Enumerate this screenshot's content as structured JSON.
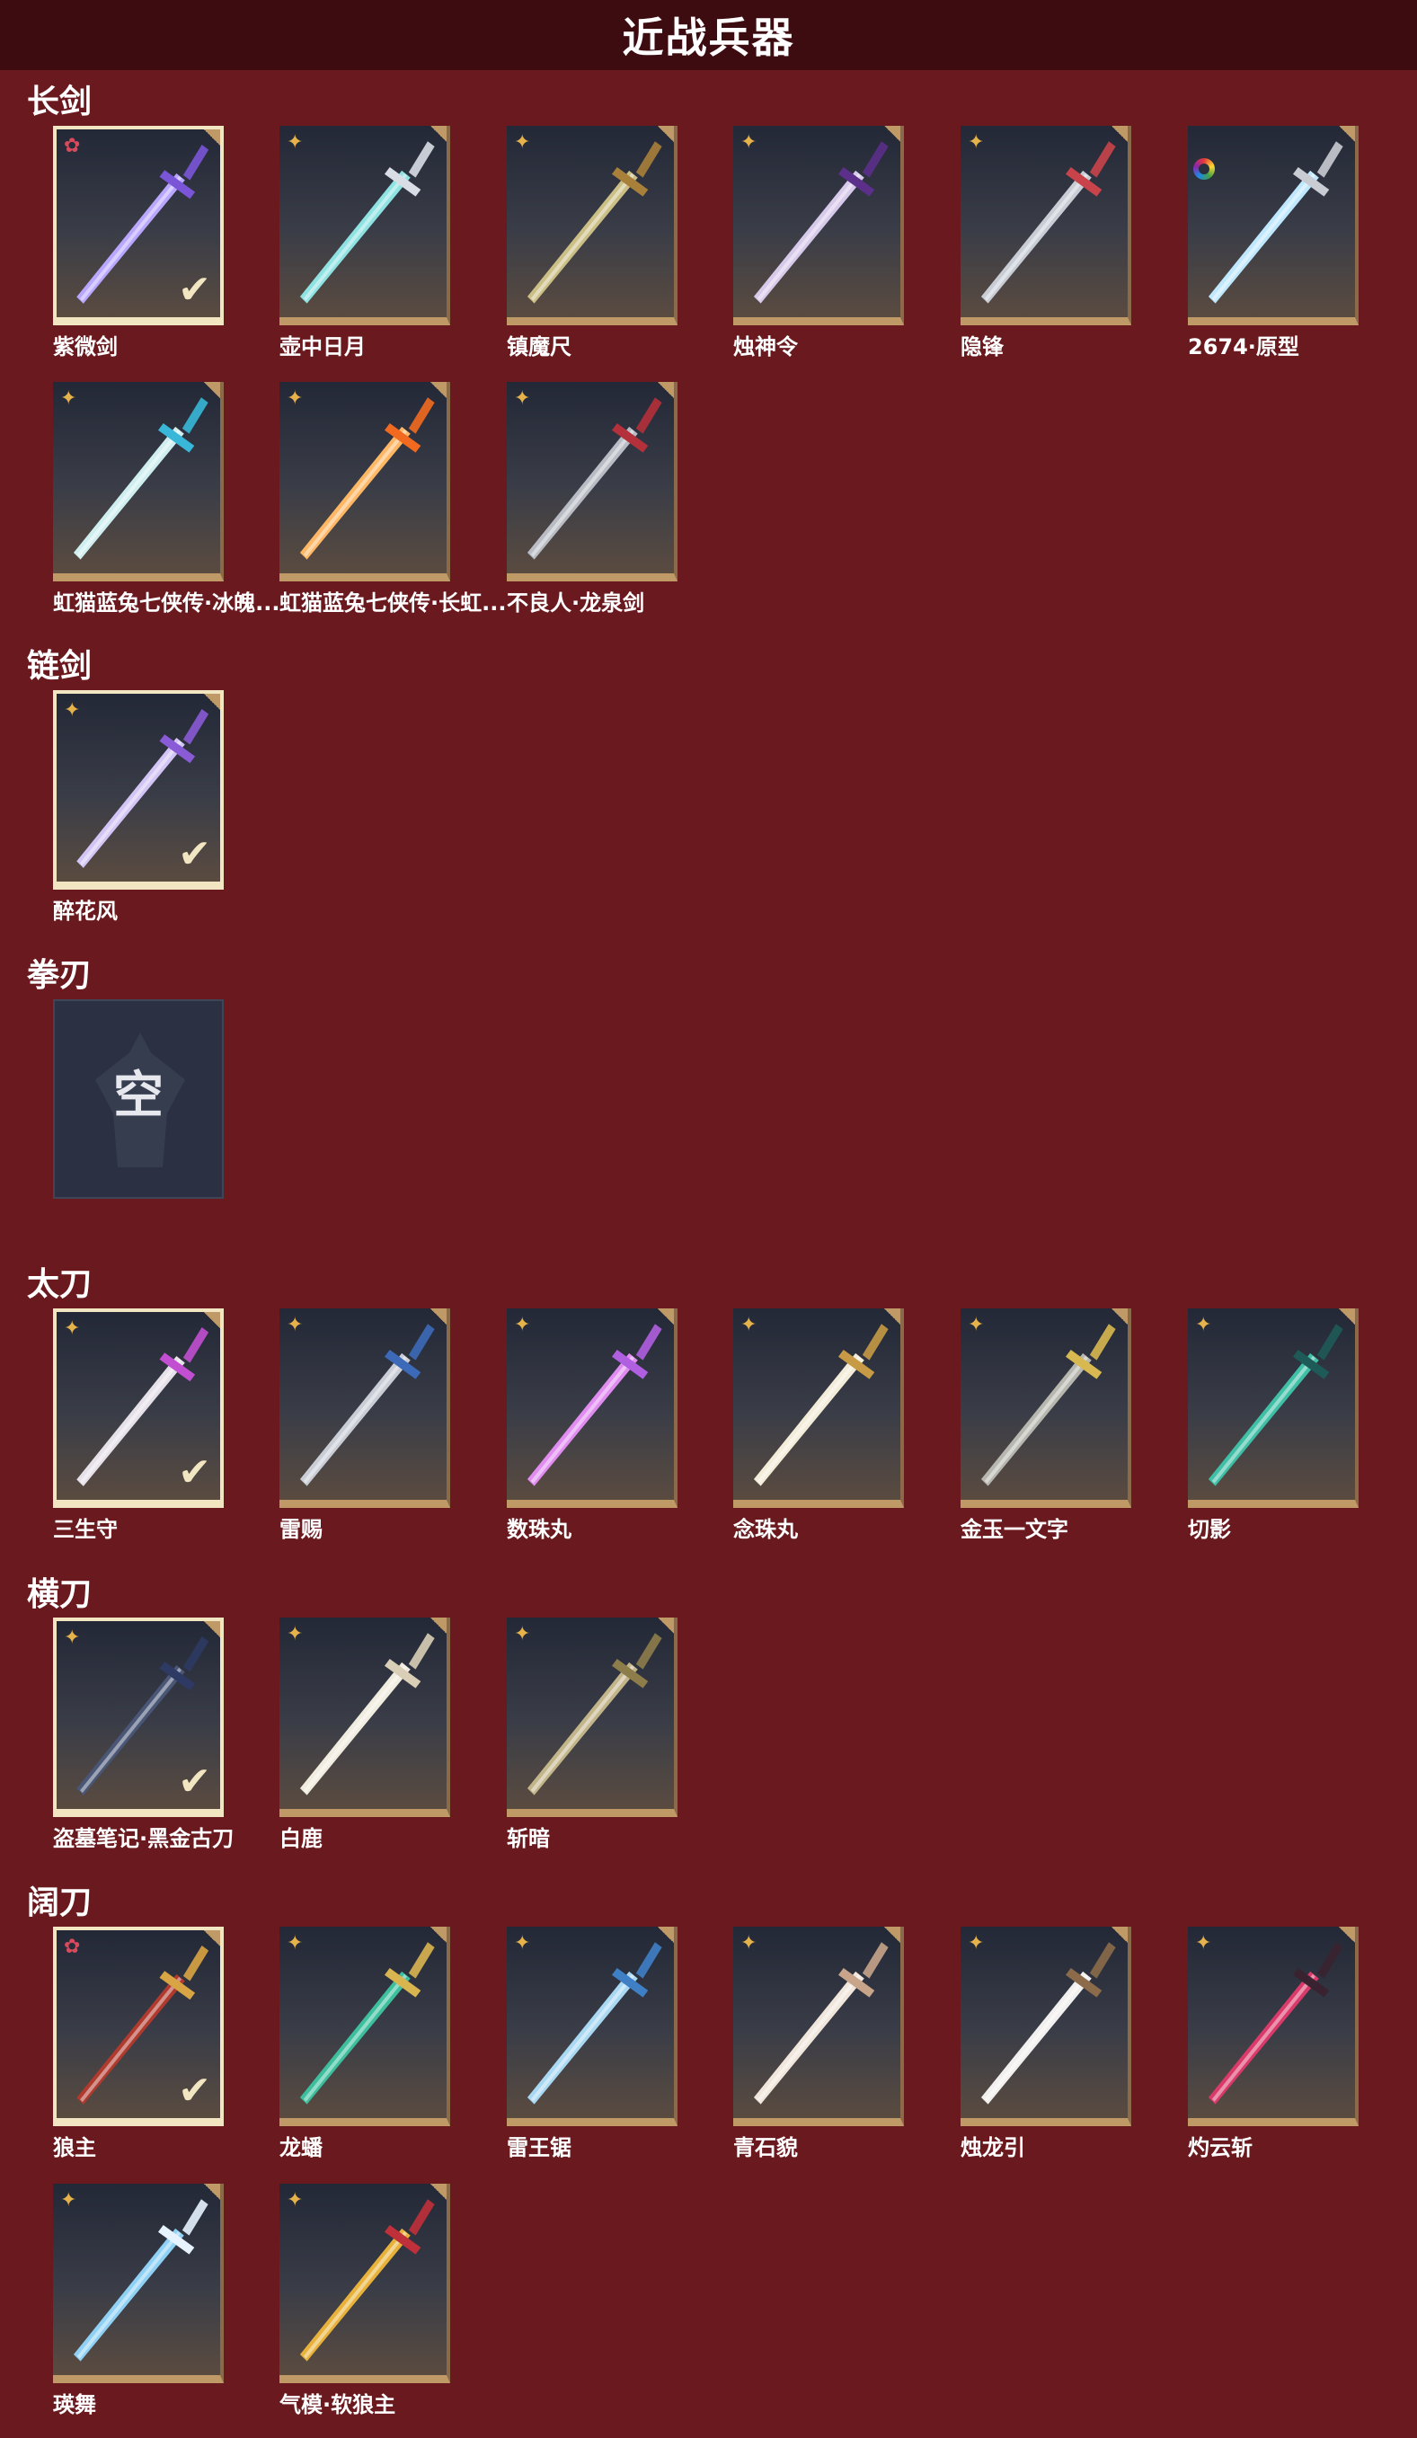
{
  "header": {
    "title": "近战兵器"
  },
  "sections": [
    {
      "title": "长剑",
      "items": [
        {
          "name": "紫微剑",
          "badge": "red-star",
          "selected": true,
          "blade": "#b9a6ff",
          "hilt": "#7a55d8"
        },
        {
          "name": "壶中日月",
          "badge": "gold-star",
          "selected": false,
          "blade": "#8ee2e2",
          "hilt": "#d8dde6"
        },
        {
          "name": "镇魔尺",
          "badge": "gold-star",
          "selected": false,
          "blade": "#cbbf86",
          "hilt": "#a8803a"
        },
        {
          "name": "烛神令",
          "badge": "gold-star",
          "selected": false,
          "blade": "#d7c9ea",
          "hilt": "#5b2f8a"
        },
        {
          "name": "隐锋",
          "badge": "gold-star",
          "selected": false,
          "blade": "#c7ccd5",
          "hilt": "#c9444a"
        },
        {
          "name": "2674·原型",
          "badge": "rainbow",
          "selected": false,
          "blade": "#bfe8ff",
          "hilt": "#c9ccd2"
        }
      ]
    },
    {
      "title": "",
      "items": [
        {
          "name": "虹猫蓝兔七侠传·冰魄...",
          "badge": "gold-star",
          "selected": false,
          "blade": "#cfeef0",
          "hilt": "#39b7d8"
        },
        {
          "name": "虹猫蓝兔七侠传·长虹...",
          "badge": "gold-star",
          "selected": false,
          "blade": "#ffb764",
          "hilt": "#f26a1f"
        },
        {
          "name": "不良人·龙泉剑",
          "badge": "gold-star",
          "selected": false,
          "blade": "#b9bcc4",
          "hilt": "#b4303a"
        }
      ]
    },
    {
      "title": "链剑",
      "items": [
        {
          "name": "醉花风",
          "badge": "gold-star",
          "selected": true,
          "blade": "#d2c4f5",
          "hilt": "#8a5bd6"
        }
      ]
    },
    {
      "title": "拳刃",
      "items": [
        {
          "name": "",
          "empty": true,
          "empty_label": "空"
        }
      ]
    },
    {
      "title": "太刀",
      "items": [
        {
          "name": "三生守",
          "badge": "gold-star",
          "selected": true,
          "blade": "#e6e1e9",
          "hilt": "#c24fd1"
        },
        {
          "name": "雷赐",
          "badge": "gold-star",
          "selected": false,
          "blade": "#c9cdd6",
          "hilt": "#3c6ab8"
        },
        {
          "name": "数珠丸",
          "badge": "gold-star",
          "selected": false,
          "blade": "#e08cf0",
          "hilt": "#b05fe0"
        },
        {
          "name": "念珠丸",
          "badge": "gold-star",
          "selected": false,
          "blade": "#f2ecd9",
          "hilt": "#c79a45"
        },
        {
          "name": "金玉一文字",
          "badge": "gold-star",
          "selected": false,
          "blade": "#b7b7b0",
          "hilt": "#d8b850"
        },
        {
          "name": "切影",
          "badge": "gold-star",
          "selected": false,
          "blade": "#3fbfa6",
          "hilt": "#1e5b58"
        }
      ]
    },
    {
      "title": "横刀",
      "items": [
        {
          "name": "盗墓笔记·黑金古刀",
          "badge": "gold-star",
          "selected": true,
          "blade": "#4a5676",
          "hilt": "#2e3a63"
        },
        {
          "name": "白鹿",
          "badge": "gold-star",
          "selected": false,
          "blade": "#f0ece0",
          "hilt": "#d8cfb6"
        },
        {
          "name": "斩暗",
          "badge": "gold-star",
          "selected": false,
          "blade": "#c3b58a",
          "hilt": "#8d7d4a"
        }
      ]
    },
    {
      "title": "阔刀",
      "items": [
        {
          "name": "狼主",
          "badge": "red-star",
          "selected": true,
          "blade": "#b03a2e",
          "hilt": "#d9a443"
        },
        {
          "name": "龙蟠",
          "badge": "gold-star",
          "selected": false,
          "blade": "#3dbf9e",
          "hilt": "#d9b550"
        },
        {
          "name": "雷王锯",
          "badge": "gold-star",
          "selected": false,
          "blade": "#a8d8f2",
          "hilt": "#3f7fc6"
        },
        {
          "name": "青石貌",
          "badge": "gold-star",
          "selected": false,
          "blade": "#f0e6dc",
          "hilt": "#c7a48a"
        },
        {
          "name": "烛龙引",
          "badge": "gold-star",
          "selected": false,
          "blade": "#f2f0ee",
          "hilt": "#8b6b4a"
        },
        {
          "name": "灼云斩",
          "badge": "gold-star",
          "selected": false,
          "blade": "#d93a6a",
          "hilt": "#3a2330"
        }
      ]
    },
    {
      "title": "",
      "items": [
        {
          "name": "瑛舞",
          "badge": "gold-star",
          "selected": false,
          "blade": "#8fd0f5",
          "hilt": "#e7f3ff"
        },
        {
          "name": "气模·软狼主",
          "badge": "gold-star",
          "selected": false,
          "blade": "#e8b23a",
          "hilt": "#c0303a"
        }
      ]
    }
  ],
  "icons": {
    "badge_gold": "four-point-star-icon",
    "badge_red": "flower-star-icon",
    "check": "checkmark-icon"
  },
  "colors": {
    "background": "#6a1a1f",
    "header": "#3d0c10",
    "gold_trim": "#c09a66",
    "selected_border": "#f2e6c2"
  }
}
